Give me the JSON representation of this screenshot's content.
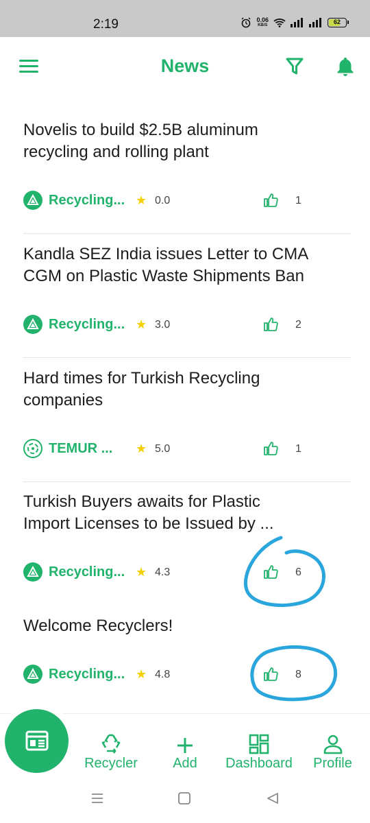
{
  "status_bar": {
    "time": "2:19",
    "net_speed_value": "0.06",
    "net_speed_unit": "KB/S",
    "battery": "62"
  },
  "header": {
    "title": "News",
    "icons": [
      "menu-icon",
      "filter-icon",
      "bell-icon"
    ]
  },
  "news": [
    {
      "title": "Novelis to build $2.5B aluminum recycling and rolling plant",
      "title_line1": "Novelis to build $2.5B aluminum",
      "title_line2": "recycling and rolling plant",
      "source": "Recycling...",
      "rating": "0.0",
      "likes": "1"
    },
    {
      "title": "Kandla SEZ India issues Letter to CMA CGM on Plastic Waste Shipments Ban",
      "title_line1": "Kandla SEZ India issues Letter to CMA",
      "title_line2": "CGM on Plastic Waste Shipments Ban",
      "source": "Recycling...",
      "rating": "3.0",
      "likes": "2"
    },
    {
      "title": "Hard times for Turkish Recycling companies",
      "title_line1": "Hard times for Turkish Recycling",
      "title_line2": "companies",
      "source": "TEMUR ...",
      "rating": "5.0",
      "likes": "1"
    },
    {
      "title": "Turkish Buyers awaits for Plastic Import Licenses to be Issued by ...",
      "title_line1": "Turkish Buyers awaits for Plastic",
      "title_line2": "Import Licenses to be Issued by ...",
      "source": "Recycling...",
      "rating": "4.3",
      "likes": "6"
    },
    {
      "title": "Welcome Recyclers!",
      "title_line1": "Welcome Recyclers!",
      "title_line2": "",
      "source": "Recycling...",
      "rating": "4.8",
      "likes": "8"
    }
  ],
  "bottom_nav": {
    "items": [
      {
        "label": "Recycler",
        "icon": "recycle-icon"
      },
      {
        "label": "Add",
        "icon": "plus-icon"
      },
      {
        "label": "Dashboard",
        "icon": "dashboard-icon"
      },
      {
        "label": "Profile",
        "icon": "person-icon"
      }
    ],
    "fab_icon": "news-icon"
  },
  "colors": {
    "accent": "#21b36b",
    "star": "#f5d000",
    "annotation": "#2ba6dc"
  }
}
